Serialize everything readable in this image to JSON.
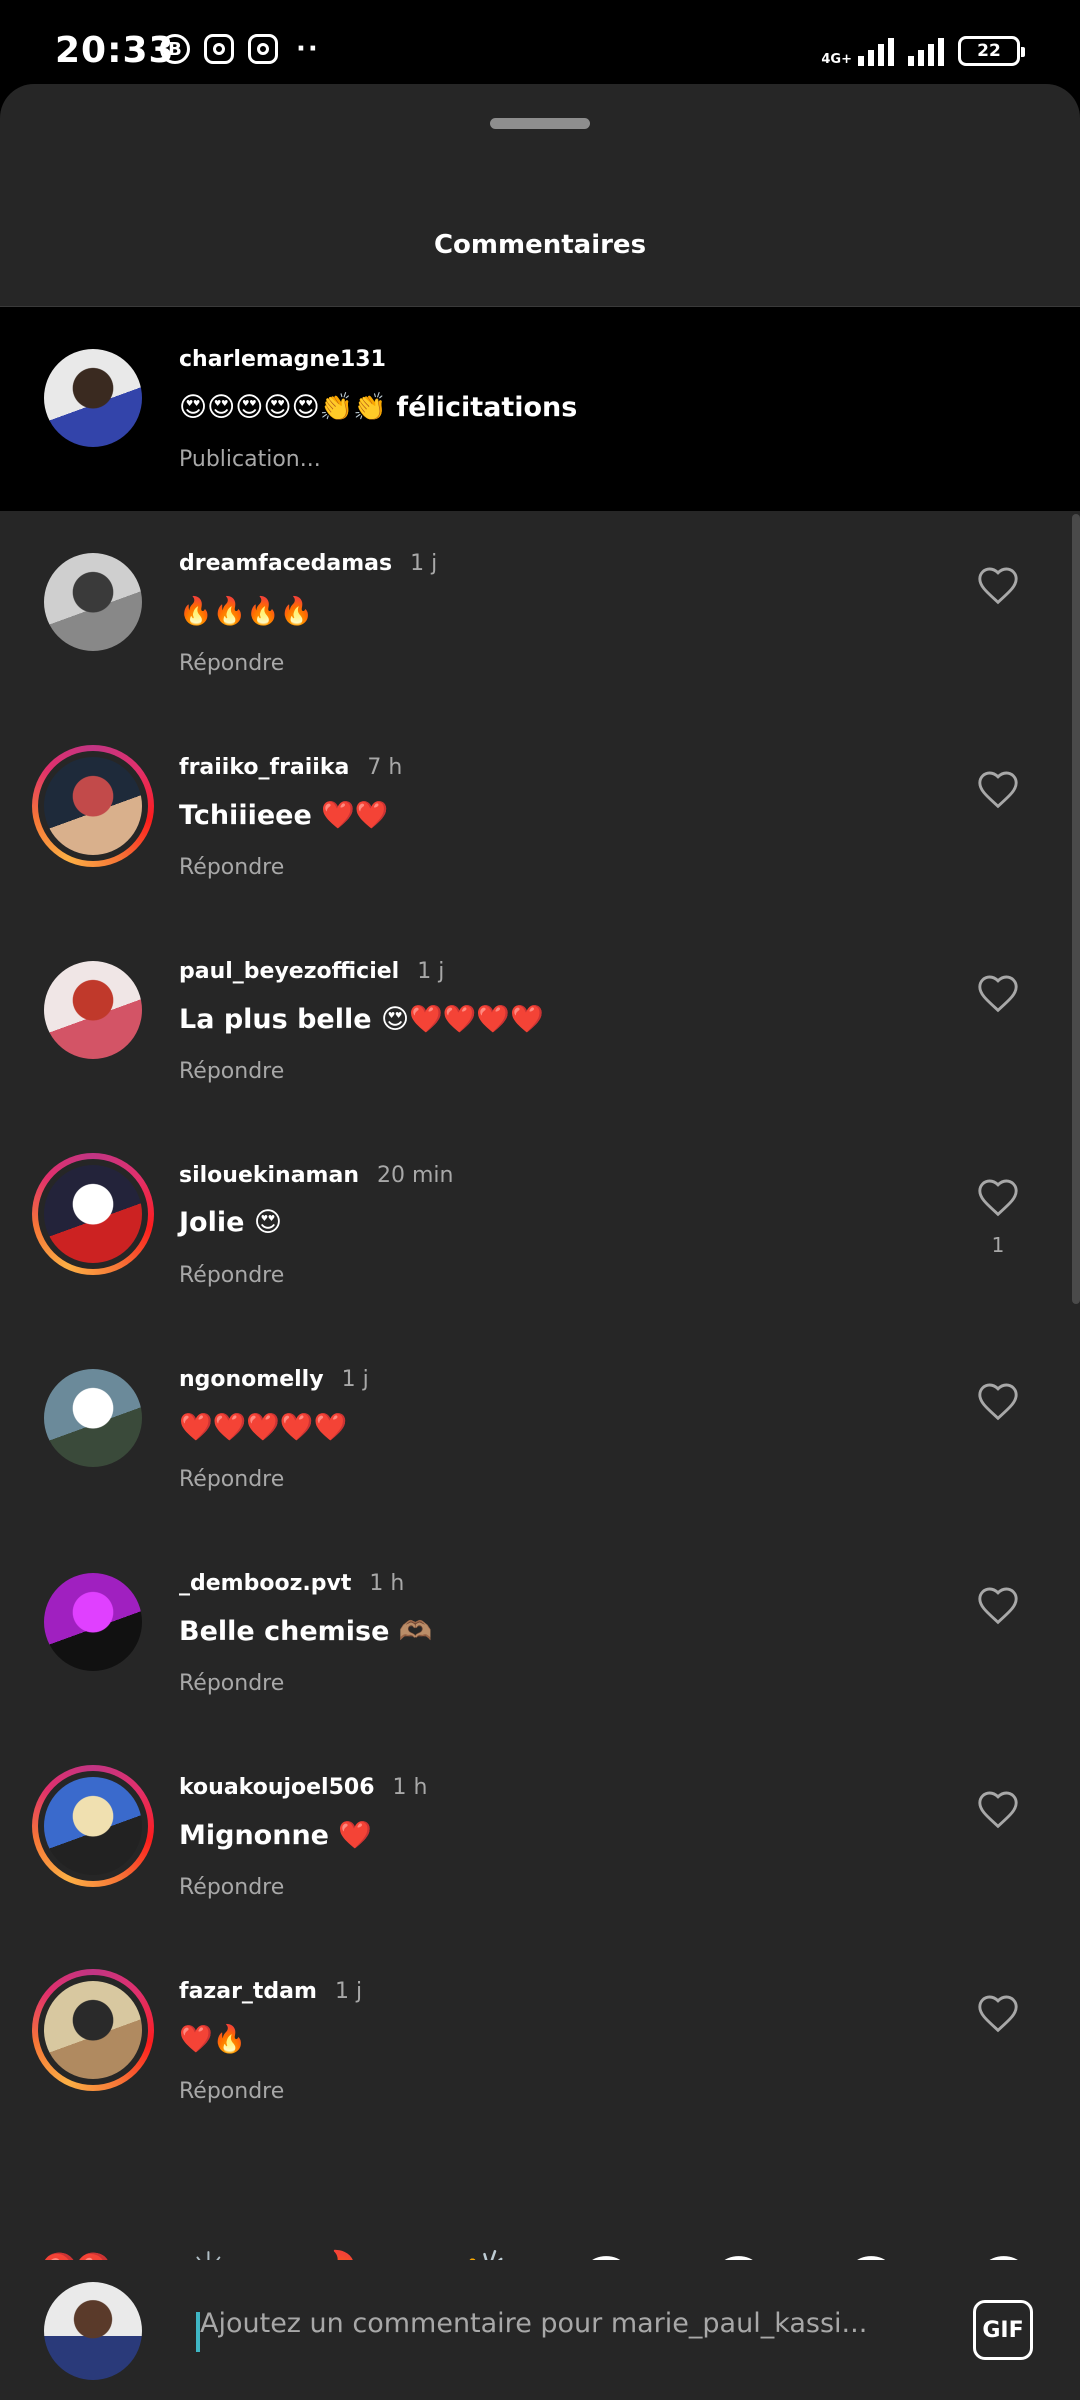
{
  "status_bar": {
    "time": "20:33",
    "b_icon": "B",
    "network": "4G+",
    "battery": "22"
  },
  "sheet": {
    "title": "Commentaires"
  },
  "comments": [
    {
      "username": "charlemagne131",
      "time": "",
      "text": "😍😍😍😍😍👏👏 félicitations",
      "action": "Publication...",
      "likes": "",
      "highlighted": true,
      "ring": false,
      "avatar_colors": [
        "#e9e9e9",
        "#3a2a20",
        "#3344aa"
      ]
    },
    {
      "username": "dreamfacedamas",
      "time": "1 j",
      "text": "🔥🔥🔥🔥",
      "action": "Répondre",
      "likes": "",
      "ring": false,
      "avatar_colors": [
        "#cfcfcf",
        "#3a3a3a",
        "#888888"
      ]
    },
    {
      "username": "fraiiko_fraiika",
      "time": "7 h",
      "text": "Tchiiieee ❤️❤️",
      "action": "Répondre",
      "likes": "",
      "ring": true,
      "avatar_colors": [
        "#1e2a3a",
        "#c24a4a",
        "#d9b08c"
      ]
    },
    {
      "username": "paul_beyezofficiel",
      "time": "1 j",
      "text": "La plus belle 😍❤️❤️❤️❤️",
      "action": "Répondre",
      "likes": "",
      "ring": false,
      "avatar_colors": [
        "#f0e6e6",
        "#c0392b",
        "#d35466"
      ]
    },
    {
      "username": "silouekinaman",
      "time": "20 min",
      "text": "Jolie 😍",
      "action": "Répondre",
      "likes": "1",
      "ring": true,
      "avatar_colors": [
        "#23233a",
        "#ffffff",
        "#cc2222"
      ]
    },
    {
      "username": "ngonomelly",
      "time": "1 j",
      "text": "❤️❤️❤️❤️❤️",
      "action": "Répondre",
      "likes": "",
      "ring": false,
      "avatar_colors": [
        "#6b8a9a",
        "#ffffff",
        "#3a4a3a"
      ]
    },
    {
      "username": "_dembooz.pvt",
      "time": "1 h",
      "text": "Belle chemise 🫶🏽",
      "action": "Répondre",
      "likes": "",
      "ring": false,
      "avatar_colors": [
        "#a020c0",
        "#e040ff",
        "#111111"
      ]
    },
    {
      "username": "kouakoujoel506",
      "time": "1 h",
      "text": "Mignonne ❤️",
      "action": "Répondre",
      "likes": "",
      "ring": true,
      "avatar_colors": [
        "#3a6acc",
        "#f0e0b0",
        "#222222"
      ]
    },
    {
      "username": "fazar_tdam",
      "time": "1 j",
      "text": "❤️🔥",
      "action": "Répondre",
      "likes": "",
      "ring": true,
      "avatar_colors": [
        "#d8c8a0",
        "#2a2a2a",
        "#b08a60"
      ]
    }
  ],
  "emoji_bar": [
    {
      "emoji": "❤️",
      "variants": false
    },
    {
      "emoji": "🙌",
      "variants": true
    },
    {
      "emoji": "🔥",
      "variants": false
    },
    {
      "emoji": "👏",
      "variants": true
    },
    {
      "emoji": "😢",
      "variants": false
    },
    {
      "emoji": "😍",
      "variants": false
    },
    {
      "emoji": "😮",
      "variants": false
    },
    {
      "emoji": "😂",
      "variants": false
    }
  ],
  "composer": {
    "placeholder": "Ajoutez un commentaire pour marie_paul_kassi...",
    "gif_label": "GIF"
  }
}
